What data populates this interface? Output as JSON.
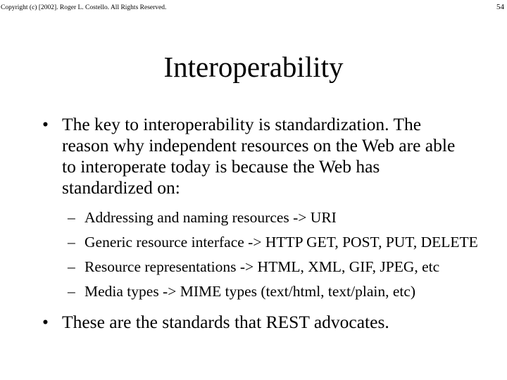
{
  "header": {
    "copyright": "Copyright (c) [2002]. Roger L. Costello. All Rights Reserved.",
    "page_number": "54"
  },
  "slide": {
    "title": "Interoperability",
    "bullet_glyph": "•",
    "dash_glyph": "–",
    "bullets": [
      {
        "text": "The key to interoperability is standardization.  The reason why independent resources on the Web are able to interoperate today is because the Web has standardized on:",
        "sub": [
          "Addressing and naming resources -> URI",
          "Generic resource interface -> HTTP GET, POST, PUT, DELETE",
          "Resource representations -> HTML, XML, GIF, JPEG, etc",
          "Media types -> MIME types (text/html, text/plain, etc)"
        ]
      },
      {
        "text": "These are the standards that REST advocates."
      }
    ]
  }
}
